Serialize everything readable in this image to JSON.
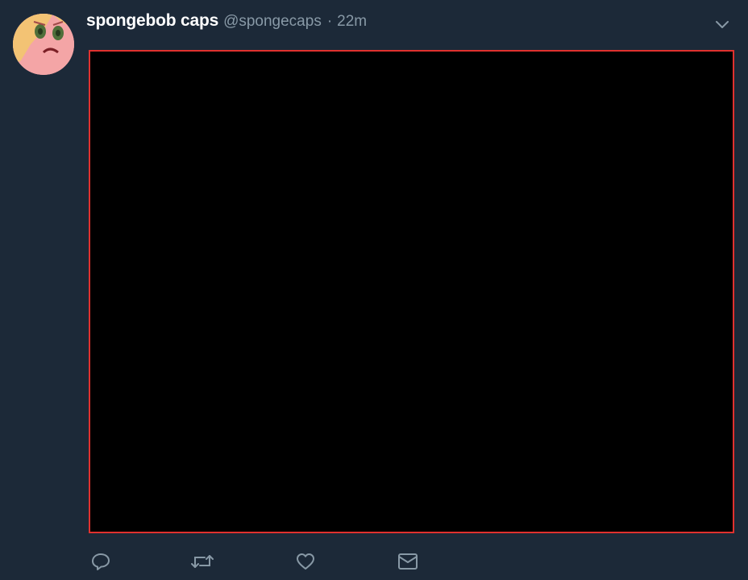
{
  "tweet": {
    "display_name": "spongebob caps",
    "handle": "@spongecaps",
    "separator": "·",
    "timestamp": "22m"
  },
  "media": {
    "border_color": "#e0312e",
    "fill_color": "#000000"
  },
  "actions": {
    "reply_icon": "reply-icon",
    "retweet_icon": "retweet-icon",
    "like_icon": "heart-icon",
    "dm_icon": "envelope-icon"
  },
  "colors": {
    "background": "#1c2938",
    "name_text": "#ffffff",
    "secondary_text": "#8899a6"
  }
}
